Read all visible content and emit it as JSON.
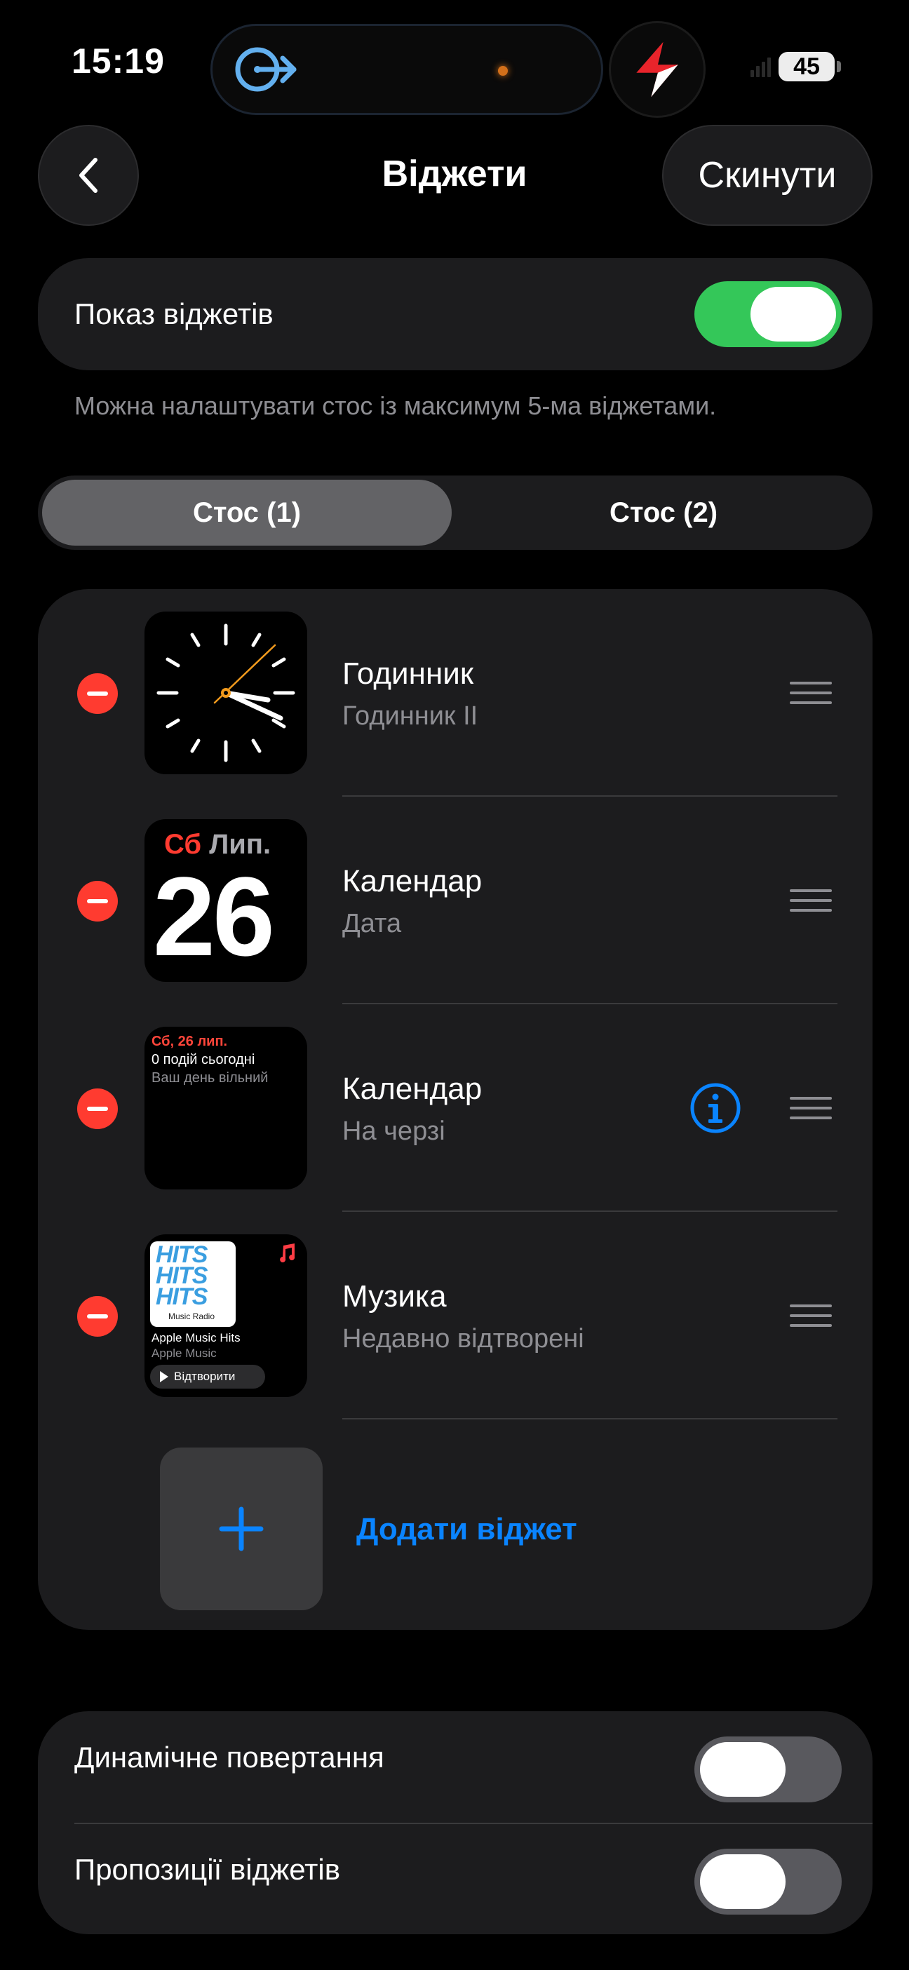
{
  "status_bar": {
    "time": "15:19",
    "battery": "45"
  },
  "nav": {
    "title": "Віджети",
    "reset_label": "Скинути"
  },
  "show_widgets": {
    "label": "Показ віджетів",
    "enabled": true
  },
  "footnote": "Можна налаштувати стос із максимум 5-ма віджетами.",
  "tabs": [
    {
      "label": "Стос (1)",
      "selected": true
    },
    {
      "label": "Стос (2)",
      "selected": false
    }
  ],
  "widgets": [
    {
      "title": "Годинник",
      "subtitle": "Годинник II",
      "thumbnail": "clock-face"
    },
    {
      "title": "Календар",
      "subtitle": "Дата",
      "thumbnail": "calendar-date",
      "preview": {
        "weekday": "Сб",
        "month": "Лип.",
        "day": "26"
      }
    },
    {
      "title": "Календар",
      "subtitle": "На черзі",
      "thumbnail": "calendar-up-next",
      "has_info": true,
      "preview": {
        "date": "Сб, 26 лип.",
        "events": "0 подій сьогодні",
        "note": "Ваш день вільний"
      }
    },
    {
      "title": "Музика",
      "subtitle": "Недавно відтворені",
      "thumbnail": "music-recent",
      "preview": {
        "art_text": "HITS",
        "radio": "Music Radio",
        "playlist": "Apple Music Hits",
        "source": "Apple Music",
        "play": "Відтворити"
      }
    }
  ],
  "add_widget": {
    "label": "Додати віджет"
  },
  "settings": [
    {
      "label": "Динамічне повертання",
      "enabled": false
    },
    {
      "label": "Пропозиції віджетів",
      "enabled": false
    }
  ],
  "colors": {
    "accent": "#0a84ff",
    "toggle_on": "#34c759",
    "remove": "#ff3b30",
    "calendar_red": "#ff3b30"
  }
}
